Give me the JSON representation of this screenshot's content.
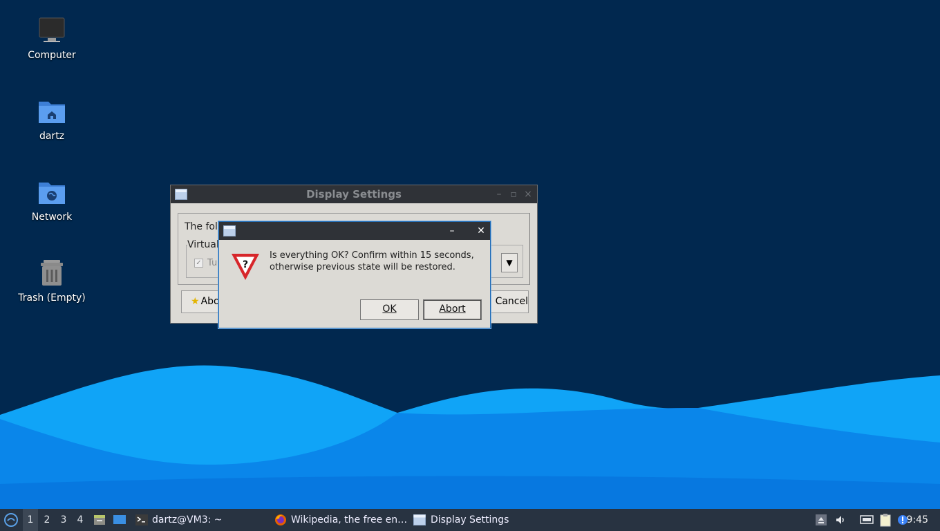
{
  "desktop": {
    "icons": [
      {
        "label": "Computer"
      },
      {
        "label": "dartz"
      },
      {
        "label": "Network"
      },
      {
        "label": "Trash (Empty)"
      }
    ]
  },
  "display_settings_window": {
    "title": "Display Settings",
    "text_partial": "The foll",
    "group_label_partial": "Virtual",
    "checkbox_label_partial": "Tu",
    "about_label_partial": "Abo",
    "cancel_label_partial": "Cancel"
  },
  "confirm_dialog": {
    "message_line1": "Is everything OK? Confirm within 15 seconds,",
    "message_line2": "otherwise previous state will be restored.",
    "ok_label": "OK",
    "abort_label": "Abort"
  },
  "taskbar": {
    "workspaces": [
      "1",
      "2",
      "3",
      "4"
    ],
    "active_workspace": "1",
    "tasks": [
      {
        "label": "dartz@VM3: ~",
        "icon": "terminal-icon"
      },
      {
        "label": "Wikipedia, the free en…",
        "icon": "firefox-icon"
      },
      {
        "label": "Display Settings",
        "icon": "window-icon"
      }
    ],
    "clock": "9:45"
  },
  "colors": {
    "desktop_bg": "#01284f",
    "wave_light": "#0a8ef0",
    "wave_dark": "#0571dd",
    "taskbar_bg": "#283341",
    "titlebar_bg": "#2f3237",
    "dialog_bg": "#dcdad5"
  }
}
